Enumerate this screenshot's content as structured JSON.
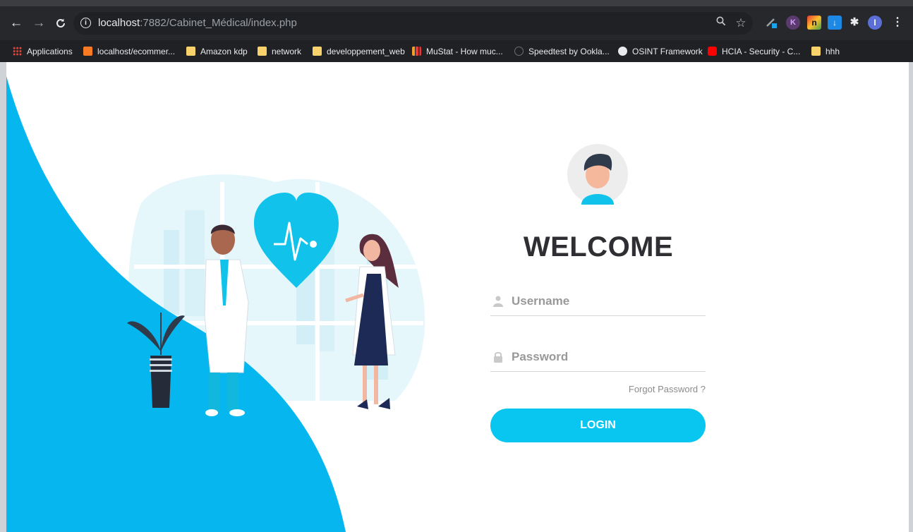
{
  "browser": {
    "url_host": "localhost",
    "url_rest": ":7882/Cabinet_Médical/index.php",
    "nav": {
      "back_icon": "arrow-left-icon",
      "forward_icon": "arrow-right-icon",
      "reload_icon": "reload-icon"
    },
    "omnibox_icons": [
      "zoom-icon",
      "star-icon"
    ],
    "extension_icons": [
      "pen-extension-icon",
      "k-extension-icon",
      "n-extension-icon",
      "download-extension-icon",
      "puzzle-icon",
      "profile-icon",
      "kebab-menu-icon"
    ],
    "profile_initial": "I",
    "k_extension_letter": "K",
    "n_extension_letter": "n",
    "bookmarks": [
      {
        "label": "Applications",
        "icon": "apps-grid-icon"
      },
      {
        "label": "localhost/ecommer...",
        "icon": "xampp-icon"
      },
      {
        "label": "Amazon kdp",
        "icon": "folder-icon"
      },
      {
        "label": "network",
        "icon": "folder-icon"
      },
      {
        "label": "developpement_web",
        "icon": "folder-icon"
      },
      {
        "label": "MuStat - How muc...",
        "icon": "bars-icon"
      },
      {
        "label": "Speedtest by Ookla...",
        "icon": "speedtest-icon"
      },
      {
        "label": "OSINT Framework",
        "icon": "globe-icon"
      },
      {
        "label": "HCIA - Security - C...",
        "icon": "youtube-icon"
      },
      {
        "label": "hhh",
        "icon": "folder-icon"
      }
    ]
  },
  "colors": {
    "accent": "#08c6ef",
    "wave": "#06b6ef",
    "heart": "#11c2eb",
    "heading": "#2f2f33",
    "placeholder": "#999999"
  },
  "login": {
    "heading": "WELCOME",
    "username_placeholder": "Username",
    "password_placeholder": "Password",
    "forgot_label": "Forgot Password ?",
    "login_label": "LOGIN",
    "avatar_icon": "user-avatar-icon",
    "username_icon": "user-icon",
    "password_icon": "lock-icon"
  }
}
